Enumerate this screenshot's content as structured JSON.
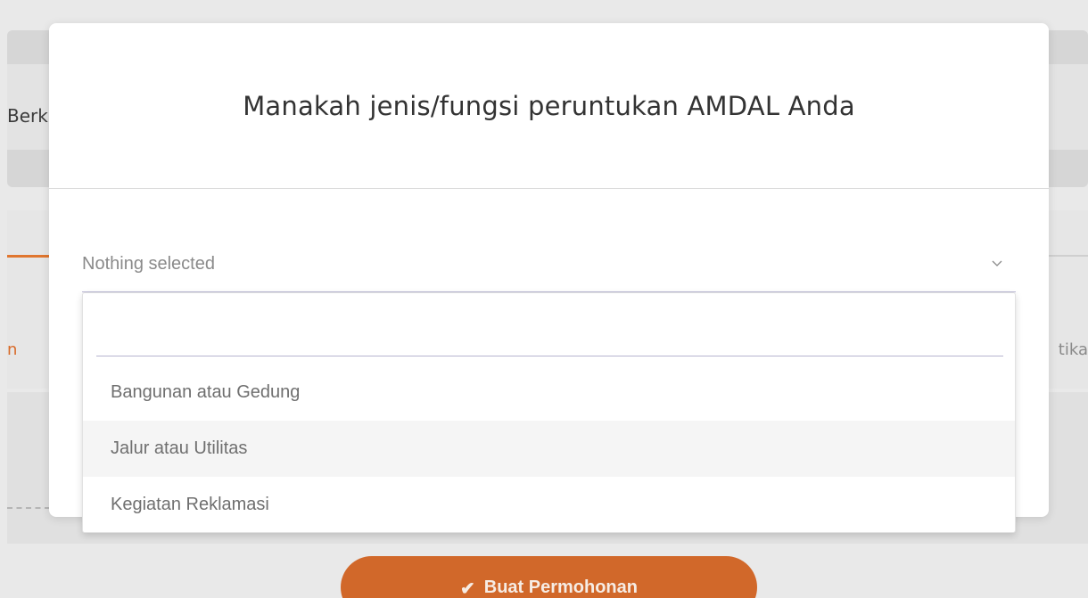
{
  "background": {
    "topbar_partial_text": "Berk",
    "tab_left_partial_text": "n",
    "tab_right_partial_text": "tika",
    "primary_button": {
      "icon": "check-icon",
      "label": "Buat Permohonan"
    }
  },
  "modal": {
    "title": "Manakah jenis/fungsi peruntukan AMDAL Anda",
    "select": {
      "value": "Nothing selected",
      "search_value": "",
      "options": [
        {
          "label": "Bangunan atau Gedung",
          "highlighted": false
        },
        {
          "label": "Jalur atau Utilitas",
          "highlighted": true
        },
        {
          "label": "Kegiatan Reklamasi",
          "highlighted": false
        }
      ]
    }
  },
  "colors": {
    "accent": "#d1682a",
    "tab_accent": "#e0762f"
  }
}
